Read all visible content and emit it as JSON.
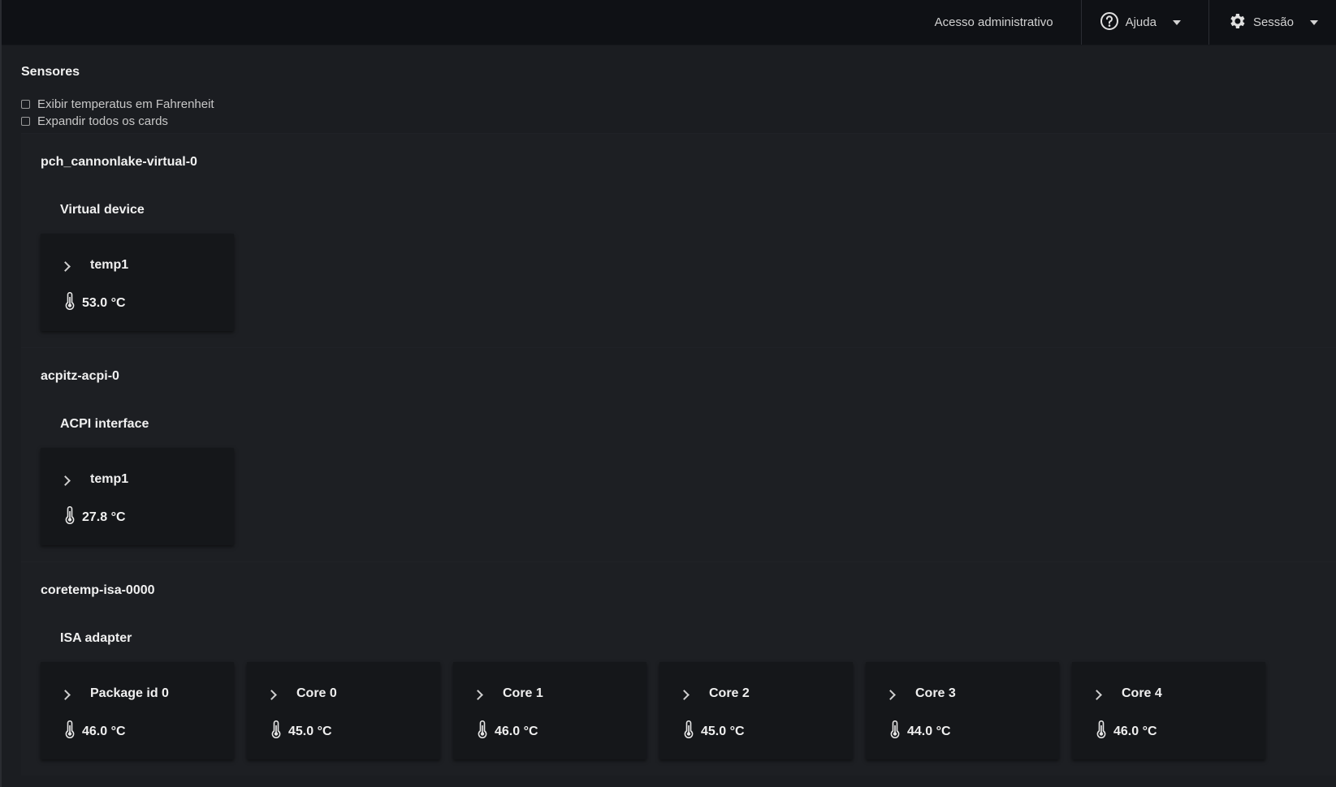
{
  "topbar": {
    "admin_label": "Acesso administrativo",
    "help_label": "Ajuda",
    "session_label": "Sessão"
  },
  "page": {
    "title": "Sensores",
    "options": [
      {
        "label": "Exibir temperatus em Fahrenheit",
        "checked": false
      },
      {
        "label": "Expandir todos os cards",
        "checked": false
      }
    ]
  },
  "devices": [
    {
      "name": "pch_cannonlake-virtual-0",
      "adapter": "Virtual device",
      "sensors": [
        {
          "label": "temp1",
          "value": "53.0 °C"
        }
      ]
    },
    {
      "name": "acpitz-acpi-0",
      "adapter": "ACPI interface",
      "sensors": [
        {
          "label": "temp1",
          "value": "27.8 °C"
        }
      ]
    },
    {
      "name": "coretemp-isa-0000",
      "adapter": "ISA adapter",
      "sensors": [
        {
          "label": "Package id 0",
          "value": "46.0 °C"
        },
        {
          "label": "Core 0",
          "value": "45.0 °C"
        },
        {
          "label": "Core 1",
          "value": "46.0 °C"
        },
        {
          "label": "Core 2",
          "value": "45.0 °C"
        },
        {
          "label": "Core 3",
          "value": "44.0 °C"
        },
        {
          "label": "Core 4",
          "value": "46.0 °C"
        }
      ]
    }
  ],
  "icons": {
    "help": "question-circle-icon",
    "session": "gear-icon",
    "thermometer": "thermometer-icon",
    "expand": "chevron-right-icon"
  }
}
